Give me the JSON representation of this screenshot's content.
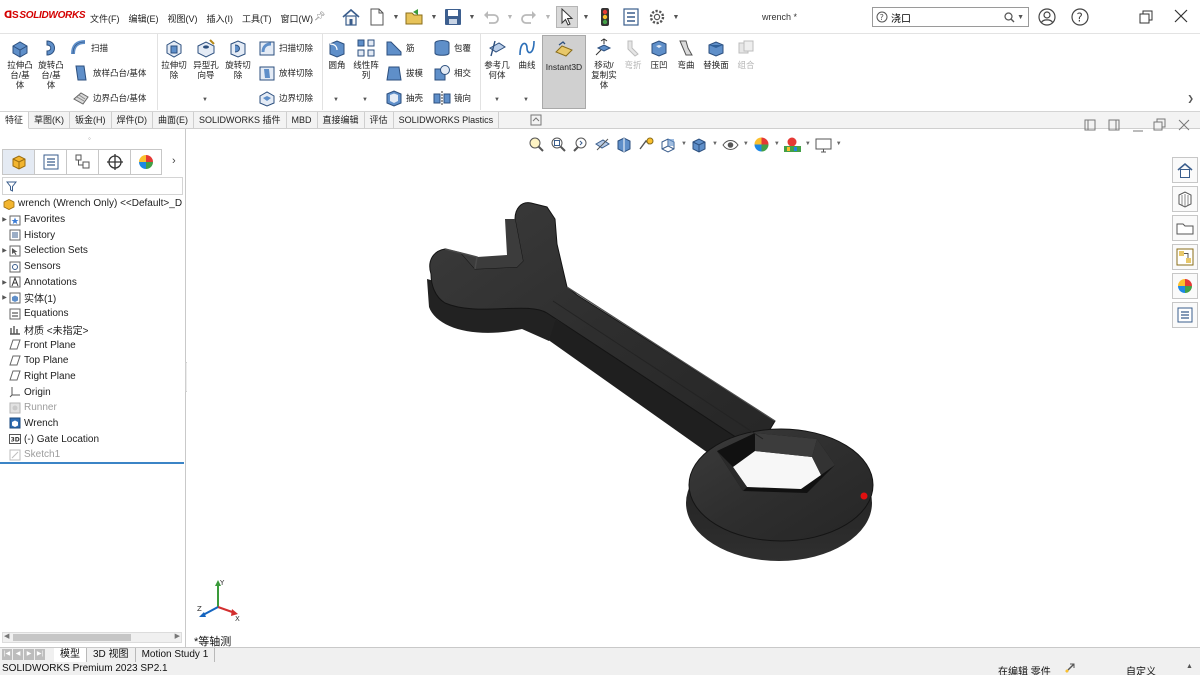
{
  "app": {
    "brand": "SOLIDWORKS",
    "document_title": "wrench *"
  },
  "menu": [
    "文件(F)",
    "编辑(E)",
    "视图(V)",
    "插入(I)",
    "工具(T)",
    "窗口(W)"
  ],
  "search": {
    "value": "浇口"
  },
  "ribbon": {
    "boss_extrude": "拉伸凸\n台/基\n体",
    "revolve_boss": "旋转凸\n台/基\n体",
    "sweep": "扫描",
    "loft_boss": "放样凸台/基体",
    "boundary_boss": "边界凸台/基体",
    "extrude_cut": "拉伸切\n除",
    "hole_wizard": "异型孔\n向导",
    "revolve_cut": "旋转切\n除",
    "swept_cut": "扫描切除",
    "lofted_cut": "放样切除",
    "boundary_cut": "边界切除",
    "fillet": "圆角",
    "linear_pattern": "线性阵\n列",
    "rib": "筋",
    "draft": "拔模",
    "shell": "抽壳",
    "wrap": "包覆",
    "intersect": "相交",
    "mirror": "镜向",
    "ref_geometry": "参考几\n何体",
    "curves": "曲线",
    "instant3d": "Instant3D",
    "move_copy": "移动/\n复制实\n体",
    "flex": "弯折",
    "indent": "压凹",
    "deform": "弯曲",
    "replace_face": "替换面",
    "combine": "组合"
  },
  "tabs": [
    "特征",
    "草图(K)",
    "钣金(H)",
    "焊件(D)",
    "曲面(E)",
    "SOLIDWORKS 插件",
    "MBD",
    "直接编辑",
    "评估",
    "SOLIDWORKS Plastics"
  ],
  "tree": {
    "root": "wrench (Wrench Only) <<Default>_D",
    "items": [
      {
        "label": "Favorites",
        "expand": true
      },
      {
        "label": "History",
        "expand": false
      },
      {
        "label": "Selection Sets",
        "expand": true
      },
      {
        "label": "Sensors",
        "expand": false
      },
      {
        "label": "Annotations",
        "expand": true
      },
      {
        "label": "实体(1)",
        "expand": true
      },
      {
        "label": "Equations",
        "expand": false
      },
      {
        "label": "材质 <未指定>",
        "expand": false
      },
      {
        "label": "Front Plane",
        "expand": false
      },
      {
        "label": "Top Plane",
        "expand": false
      },
      {
        "label": "Right Plane",
        "expand": false
      },
      {
        "label": "Origin",
        "expand": false
      },
      {
        "label": "Runner",
        "expand": false
      },
      {
        "label": "Wrench",
        "expand": false
      },
      {
        "label": "(-) Gate Location",
        "expand": false
      },
      {
        "label": "Sketch1",
        "expand": false
      }
    ]
  },
  "viewport": {
    "view_label": "*等轴测",
    "triad": {
      "x": "X",
      "y": "Y",
      "z": "Z"
    }
  },
  "bottom_tabs": [
    "模型",
    "3D 视图",
    "Motion Study 1"
  ],
  "status": {
    "product": "SOLIDWORKS Premium 2023 SP2.1",
    "mode": "在编辑 零件",
    "units": "自定义"
  },
  "colors": {
    "accent": "#d40000",
    "selection_blue": "#3b84c6",
    "model": "#2b2b2b"
  }
}
